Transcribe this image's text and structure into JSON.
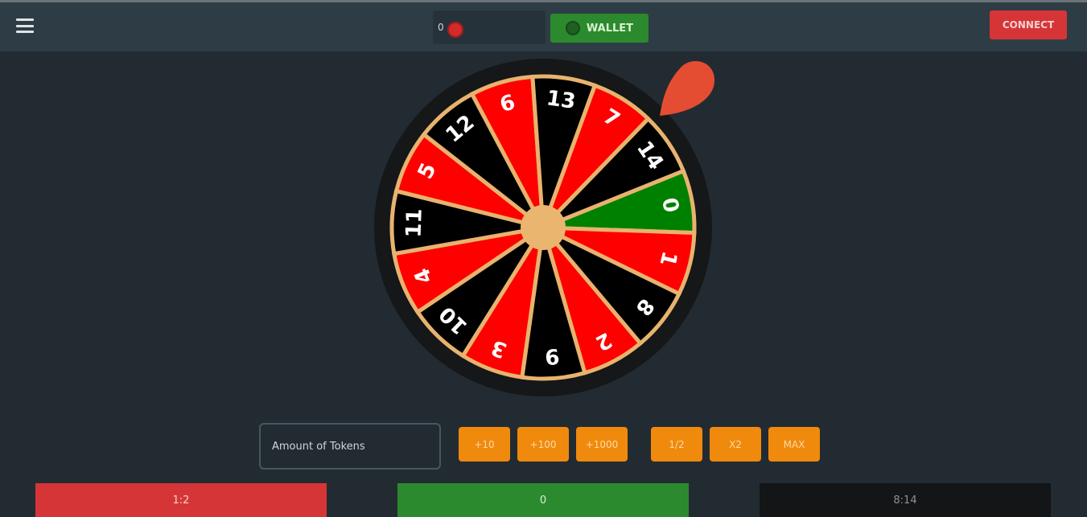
{
  "header": {
    "balance": "0",
    "wallet_label": "WALLET",
    "connect_label": "CONNECT"
  },
  "wheel": {
    "segments": [
      {
        "label": "0",
        "color": "green"
      },
      {
        "label": "1",
        "color": "red"
      },
      {
        "label": "8",
        "color": "black"
      },
      {
        "label": "2",
        "color": "red"
      },
      {
        "label": "9",
        "color": "black"
      },
      {
        "label": "3",
        "color": "red"
      },
      {
        "label": "10",
        "color": "black"
      },
      {
        "label": "4",
        "color": "red"
      },
      {
        "label": "11",
        "color": "black"
      },
      {
        "label": "5",
        "color": "red"
      },
      {
        "label": "12",
        "color": "black"
      },
      {
        "label": "6",
        "color": "red"
      },
      {
        "label": "13",
        "color": "black"
      },
      {
        "label": "7",
        "color": "red"
      },
      {
        "label": "14",
        "color": "black"
      }
    ],
    "colors": {
      "red": "#ff0000",
      "black": "#000000",
      "green": "#008000",
      "separator": "#e8b36e",
      "hub": "#eab56f",
      "rim": "#151718",
      "pointer": "#e44d32"
    }
  },
  "controls": {
    "amount_placeholder": "Amount of Tokens",
    "chips": [
      "+10",
      "+100",
      "+1000",
      "1/2",
      "X2",
      "MAX"
    ]
  },
  "bets": {
    "red_label": "1:2",
    "green_label": "0",
    "black_label": "8:14"
  }
}
